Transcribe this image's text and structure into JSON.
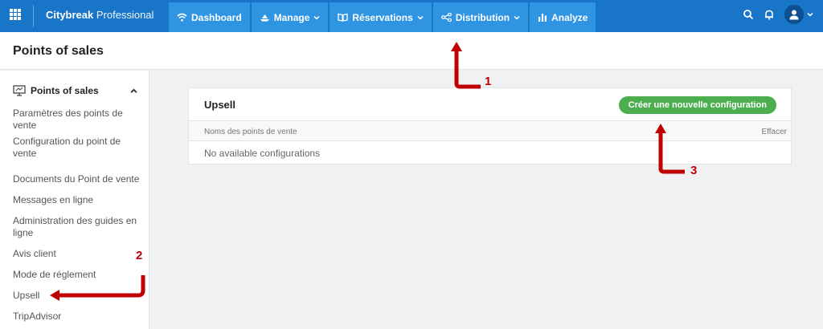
{
  "app": {
    "brand_bold": "Citybreak",
    "brand_rest": "Professional"
  },
  "nav": [
    {
      "label": "Dashboard",
      "icon": "wifi-icon"
    },
    {
      "label": "Manage",
      "icon": "ship-icon"
    },
    {
      "label": "Réservations",
      "icon": "book-icon"
    },
    {
      "label": "Distribution",
      "icon": "share-icon"
    },
    {
      "label": "Analyze",
      "icon": "bar-chart-icon"
    }
  ],
  "page": {
    "title": "Points of sales"
  },
  "sidebar": {
    "header": "Points of sales",
    "items": [
      {
        "label": "Paramètres des points de vente"
      },
      {
        "label": "Configuration du point de vente"
      },
      {
        "label": "Documents du Point de vente"
      },
      {
        "label": "Messages en ligne"
      },
      {
        "label": "Administration des guides en ligne"
      },
      {
        "label": "Avis client"
      },
      {
        "label": "Mode de réglement"
      },
      {
        "label": "Upsell"
      },
      {
        "label": "TripAdvisor"
      }
    ]
  },
  "card": {
    "title": "Upsell",
    "create_button": "Créer une nouvelle configuration",
    "columns": {
      "name": "Noms des points de vente",
      "delete": "Effacer"
    },
    "empty": "No available configurations"
  },
  "annotations": {
    "one": "1",
    "two": "2",
    "three": "3"
  },
  "colors": {
    "topbar": "#1875c8",
    "nav_item": "#2f95e3",
    "create_button": "#4cae4f",
    "annotation": "#c00000"
  }
}
